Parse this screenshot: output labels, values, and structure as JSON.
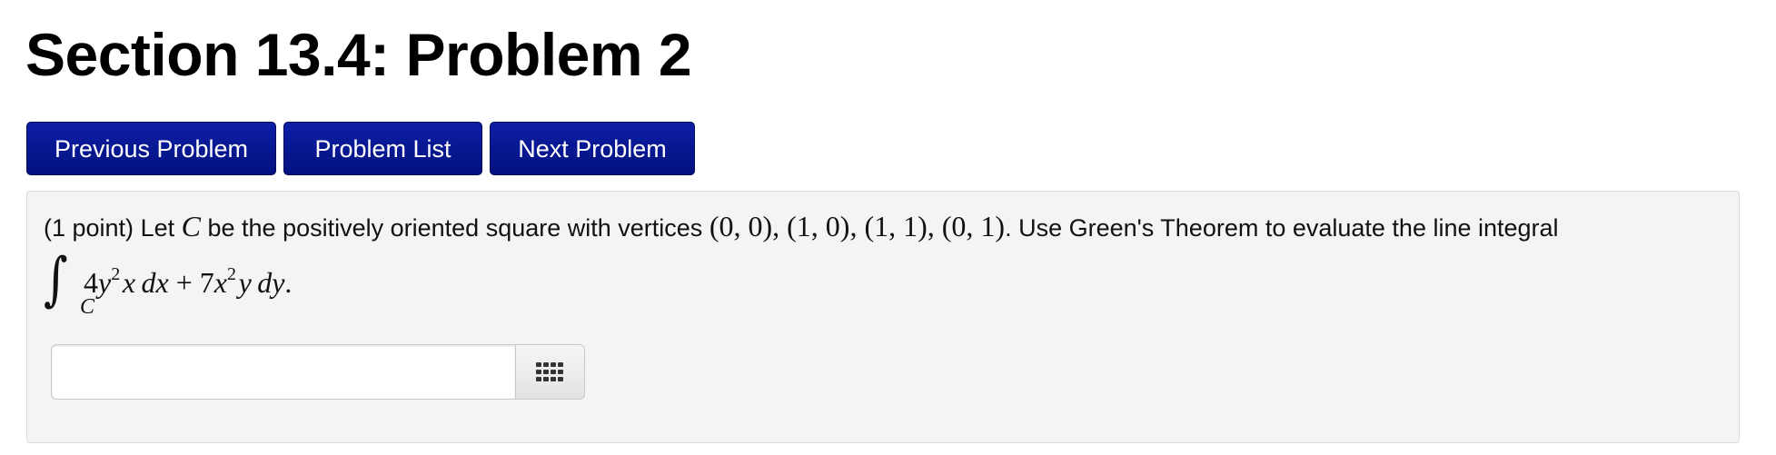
{
  "page": {
    "title": "Section 13.4: Problem 2"
  },
  "nav": {
    "previous_label": "Previous Problem",
    "list_label": "Problem List",
    "next_label": "Next Problem"
  },
  "problem": {
    "points": "(1 point)",
    "text_let": "Let",
    "var_c": "C",
    "text_square": "be the positively oriented square with vertices",
    "vertices": "(0, 0), (1, 0), (1, 1), (0, 1)",
    "text_use": ". Use Green's Theorem to evaluate the line integral",
    "integral_sign": "∫",
    "integral_subscript": "C",
    "integrand": {
      "t1_coef": "4",
      "t1_var1": "y",
      "t1_exp": "2",
      "t1_var2": "x",
      "t1_diff": "dx",
      "plus": "+",
      "t2_coef": "7",
      "t2_var1": "x",
      "t2_exp": "2",
      "t2_var2": "y",
      "t2_diff": "dy",
      "end": "."
    }
  },
  "answer": {
    "value": "",
    "placeholder": "",
    "equation_icon": "keypad-grid-icon"
  },
  "colors": {
    "button_blue": "#03127e",
    "panel_bg": "#f4f4f4"
  }
}
